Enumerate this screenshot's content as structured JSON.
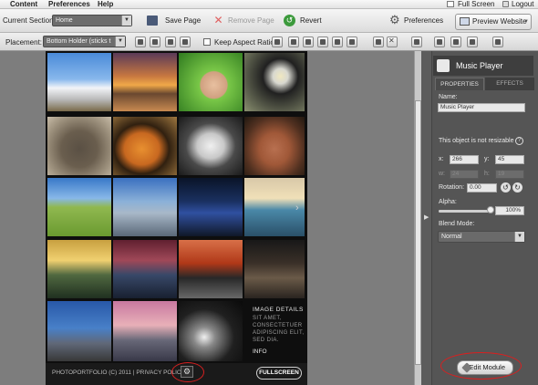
{
  "menubar": {
    "items": [
      "Content",
      "Preferences",
      "Help"
    ],
    "full_screen": "Full Screen",
    "logout": "Logout"
  },
  "toolbar": {
    "current_section_label": "Current Section:",
    "current_section_value": "Home",
    "save_page": "Save Page",
    "remove_page": "Remove Page",
    "revert": "Revert",
    "preferences": "Preferences",
    "preview_website": "Preview Website"
  },
  "toolbar2": {
    "placement_label": "Placement:",
    "placement_value": "Bottom Holder (sticks t",
    "keep_aspect_ratio": "Keep Aspect Ratio"
  },
  "canvas": {
    "image_details": {
      "title": "IMAGE DETAILS",
      "body": "SIT AMET, CONSECTETUER ADIPISCING ELIT, SED DIA.",
      "info": "INFO"
    },
    "footer_text": "PHOTOPORTFOLIO (C) 2011 | PRIVACY POLIC",
    "fullscreen_button": "FULLSCREEN"
  },
  "panel": {
    "title": "Music Player",
    "tabs": [
      "PROPERTIES",
      "EFFECTS"
    ],
    "name_label": "Name:",
    "name_value": "Music Player",
    "not_resizable": "This object is not resizable",
    "x_label": "x:",
    "x_value": "266",
    "y_label": "y:",
    "y_value": "45",
    "w_label": "w:",
    "w_value": "24",
    "h_label": "h:",
    "h_value": "19",
    "rotation_label": "Rotation:",
    "rotation_value": "0.00",
    "alpha_label": "Alpha:",
    "alpha_value": "100%",
    "alpha_level": 1.0,
    "blend_label": "Blend Mode:",
    "blend_value": "Normal",
    "edit_module": "Edit Module"
  },
  "colors": {
    "accent_red": "#d82020",
    "panel_bg": "#555555"
  }
}
